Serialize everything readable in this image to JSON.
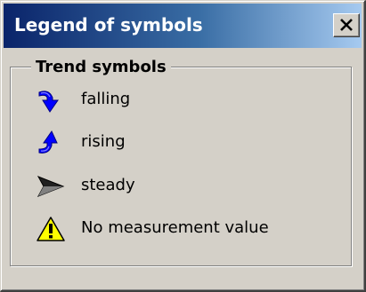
{
  "window": {
    "title": "Legend of symbols",
    "close_symbol": "X"
  },
  "group": {
    "title": "Trend symbols"
  },
  "items": [
    {
      "icon": "falling-arrow-icon",
      "label": "falling"
    },
    {
      "icon": "rising-arrow-icon",
      "label": "rising"
    },
    {
      "icon": "steady-arrow-icon",
      "label": "steady"
    },
    {
      "icon": "warning-icon",
      "label": "No measurement value"
    }
  ],
  "colors": {
    "titlebar_start": "#0a246a",
    "titlebar_end": "#a6caf0",
    "window_bg": "#d4d0c8",
    "arrow_blue": "#0000ff",
    "warning_yellow": "#ffff00"
  }
}
